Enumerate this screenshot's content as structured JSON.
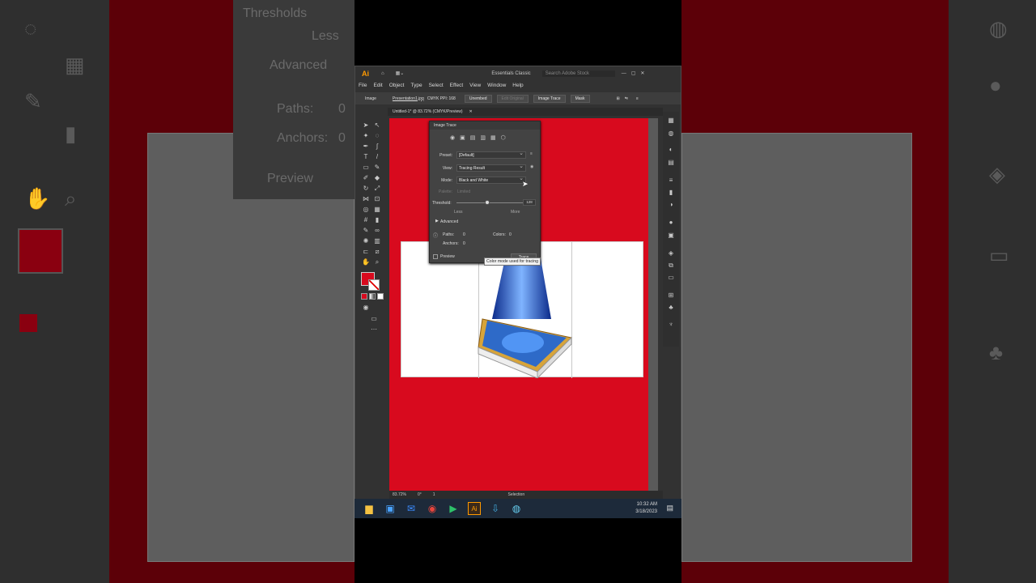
{
  "app": {
    "logo": "Ai",
    "workspace": "Essentials Classic",
    "search_placeholder": "Search Adobe Stock"
  },
  "menu": [
    "File",
    "Edit",
    "Object",
    "Type",
    "Select",
    "Effect",
    "View",
    "Window",
    "Help"
  ],
  "control": {
    "type_label": "Image",
    "file": "Presentation1.jpg",
    "mode_info": "CMYK   PPI: 168",
    "embed": "Unembed",
    "edit_original": "Edit Original",
    "image_trace": "Image Trace",
    "mask": "Mask"
  },
  "document_tab": "Untitled-1* @ 83.72% (CMYK/Preview)",
  "trace_panel": {
    "title": "Image Trace",
    "preset_label": "Preset:",
    "preset_value": "[Default]",
    "view_label": "View:",
    "view_value": "Tracing Result",
    "mode_label": "Mode:",
    "mode_value": "Black and White",
    "palette_label": "Palette:",
    "palette_value": "Limited",
    "threshold_label": "Threshold:",
    "threshold_value": "128",
    "less": "Less",
    "more": "More",
    "advanced": "Advanced",
    "paths_label": "Paths:",
    "paths_value": "0",
    "colors_label": "Colors:",
    "colors_value": "0",
    "anchors_label": "Anchors:",
    "anchors_value": "0",
    "preview": "Preview",
    "trace": "Trace"
  },
  "tooltip": "Color mode used for tracing",
  "status": {
    "zoom": "83.72%",
    "rotation": "0°",
    "artboard": "1",
    "tool": "Selection"
  },
  "taskbar": {
    "time": "10:32 AM",
    "date": "3/18/2023"
  },
  "blurred_left": {
    "threshold": "Thresholds",
    "less": "Less",
    "advanced": "Advanced",
    "paths": "Paths:",
    "paths_val": "0",
    "anchors": "Anchors:",
    "anchors_val": "0",
    "preview": "Preview"
  },
  "colors": {
    "artboard_red": "#d80a1e",
    "ui_dark": "#323232",
    "accent_orange": "#ff9a00"
  }
}
